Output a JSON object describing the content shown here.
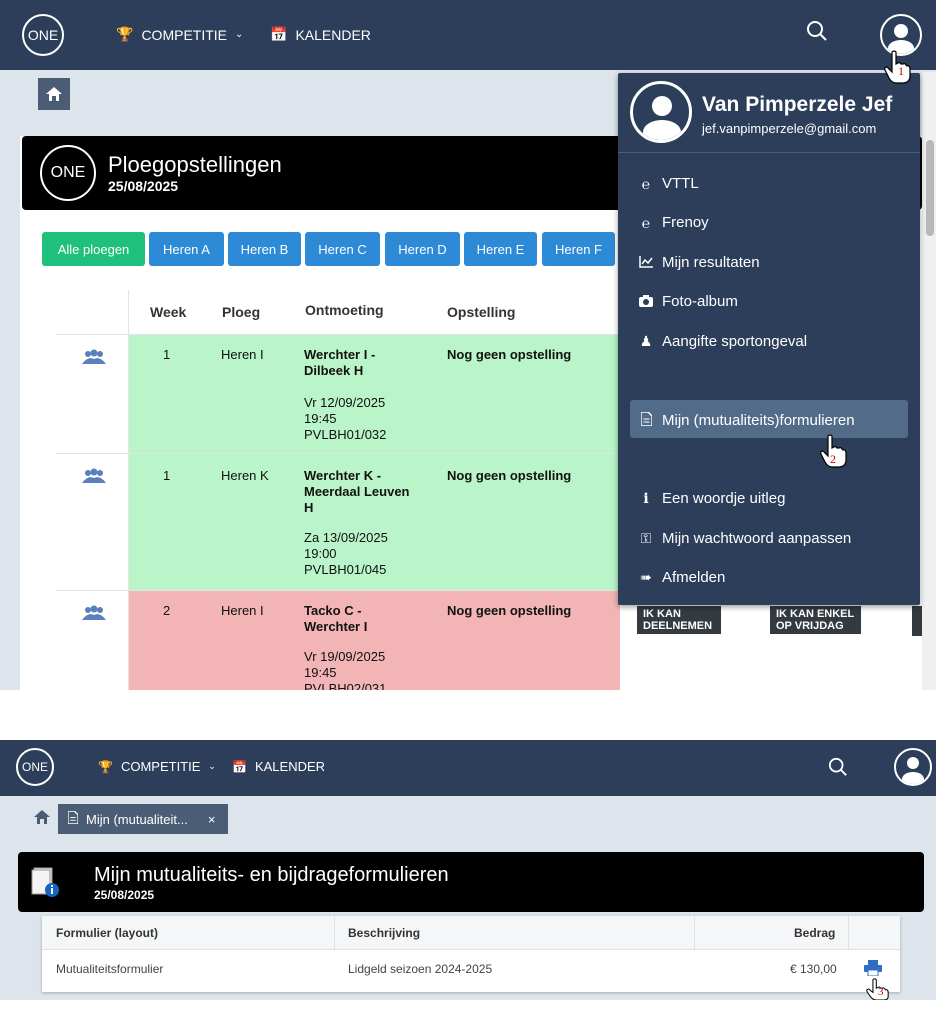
{
  "top": {
    "nav": {
      "logo": "ONE",
      "competitie": "COMPETITIE",
      "kalender": "KALENDER"
    },
    "title": {
      "logo": "ONE",
      "heading": "Ploegopstellingen",
      "date": "25/08/2025"
    },
    "team_buttons": [
      "Alle ploegen",
      "Heren A",
      "Heren B",
      "Heren C",
      "Heren D",
      "Heren E",
      "Heren F"
    ],
    "table_headers": [
      "Week",
      "Ploeg",
      "Ontmoeting",
      "Opstelling"
    ],
    "rows": [
      {
        "week": "1",
        "ploeg": "Heren I",
        "match": "Werchter I - Dilbeek H",
        "when": "Vr 12/09/2025",
        "time": "19:45",
        "code": "PVLBH01/032",
        "opstelling": "Nog geen opstelling",
        "color": "#b9f5c8"
      },
      {
        "week": "1",
        "ploeg": "Heren K",
        "match": "Werchter K - Meerdaal Leuven H",
        "when": "Za 13/09/2025",
        "time": "19:00",
        "code": "PVLBH01/045",
        "opstelling": "Nog geen opstelling",
        "color": "#b9f5c8"
      },
      {
        "week": "2",
        "ploeg": "Heren I",
        "match": "Tacko C - Werchter I",
        "when": "Vr 19/09/2025",
        "time": "19:45",
        "code": "PVLBH02/031",
        "opstelling": "Nog geen opstelling",
        "color": "#f2b4b4"
      }
    ],
    "badges": {
      "kan_deelnemen": "IK KAN DEELNEMEN",
      "kan_enkel": "IK KAN ENKEL OP VRIJDAG"
    },
    "dropdown": {
      "name": "Van Pimperzele Jef",
      "email": "jef.vanpimperzele@gmail.com",
      "items": {
        "vttl": "VTTL",
        "frenoy": "Frenoy",
        "resultaten": "Mijn resultaten",
        "foto": "Foto-album",
        "aangifte": "Aangifte sportongeval",
        "formulieren": "Mijn (mutualiteits)formulieren",
        "uitleg": "Een woordje uitleg",
        "wachtwoord": "Mijn wachtwoord aanpassen",
        "afmelden": "Afmelden"
      }
    },
    "steps": {
      "one": "1",
      "two": "2"
    }
  },
  "bottom": {
    "nav": {
      "logo": "ONE",
      "competitie": "COMPETITIE",
      "kalender": "KALENDER"
    },
    "tab_label": "Mijn (mutualiteit...",
    "tab_close": "×",
    "title": {
      "heading": "Mijn mutualiteits- en bijdrageformulieren",
      "date": "25/08/2025"
    },
    "table": {
      "headers": {
        "formulier": "Formulier (layout)",
        "beschrijving": "Beschrijving",
        "bedrag": "Bedrag"
      },
      "row": {
        "formulier": "Mutualiteitsformulier",
        "beschrijving": "Lidgeld seizoen 2024-2025",
        "bedrag": "€ 130,00"
      }
    },
    "step": "3"
  },
  "colors": {
    "nav": "#2c3e5a",
    "page_bg": "#dde4ec",
    "btn_blue": "#2d8ad6",
    "btn_green": "#1fbf7c",
    "row_green": "#b9f5c8",
    "row_red": "#f2b4b4"
  }
}
